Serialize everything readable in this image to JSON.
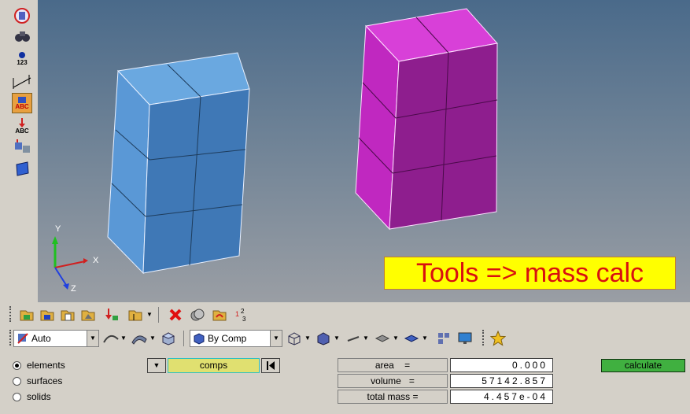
{
  "viewport": {
    "banner_text": "Tools => mass calc",
    "axis_labels": {
      "y": "Y",
      "x": "X",
      "z": "Z"
    },
    "background_top": "#4a6a8a",
    "background_bottom": "#9a9ea4",
    "solids": [
      {
        "name": "blue-box",
        "color": "#4f8fd0"
      },
      {
        "name": "magenta-box",
        "color": "#c020c0"
      }
    ]
  },
  "left_toolbar": {
    "icons": [
      "component-icon",
      "binoculars-icon",
      "numbering-icon",
      "measure-icon",
      "abc-label-icon",
      "abc-arrow-icon",
      "translate-icon",
      "plane-icon"
    ],
    "number_label": "123",
    "abc_label": "ABC",
    "abc2_label": "ABC"
  },
  "toolbar": {
    "auto_select": "Auto",
    "color_mode_select": "By Comp"
  },
  "panel": {
    "entity_options": [
      {
        "label": "elements",
        "selected": true
      },
      {
        "label": "surfaces",
        "selected": false
      },
      {
        "label": "solids",
        "selected": false
      }
    ],
    "comps_button": "comps",
    "fields": [
      {
        "label": "area",
        "value": "0.000"
      },
      {
        "label": "volume",
        "value": "57142.857"
      },
      {
        "label": "total mass",
        "value": "4.457e-04"
      }
    ],
    "calculate_button": "calculate",
    "accent_green": "#40b040",
    "comps_color": "#e0e070"
  }
}
